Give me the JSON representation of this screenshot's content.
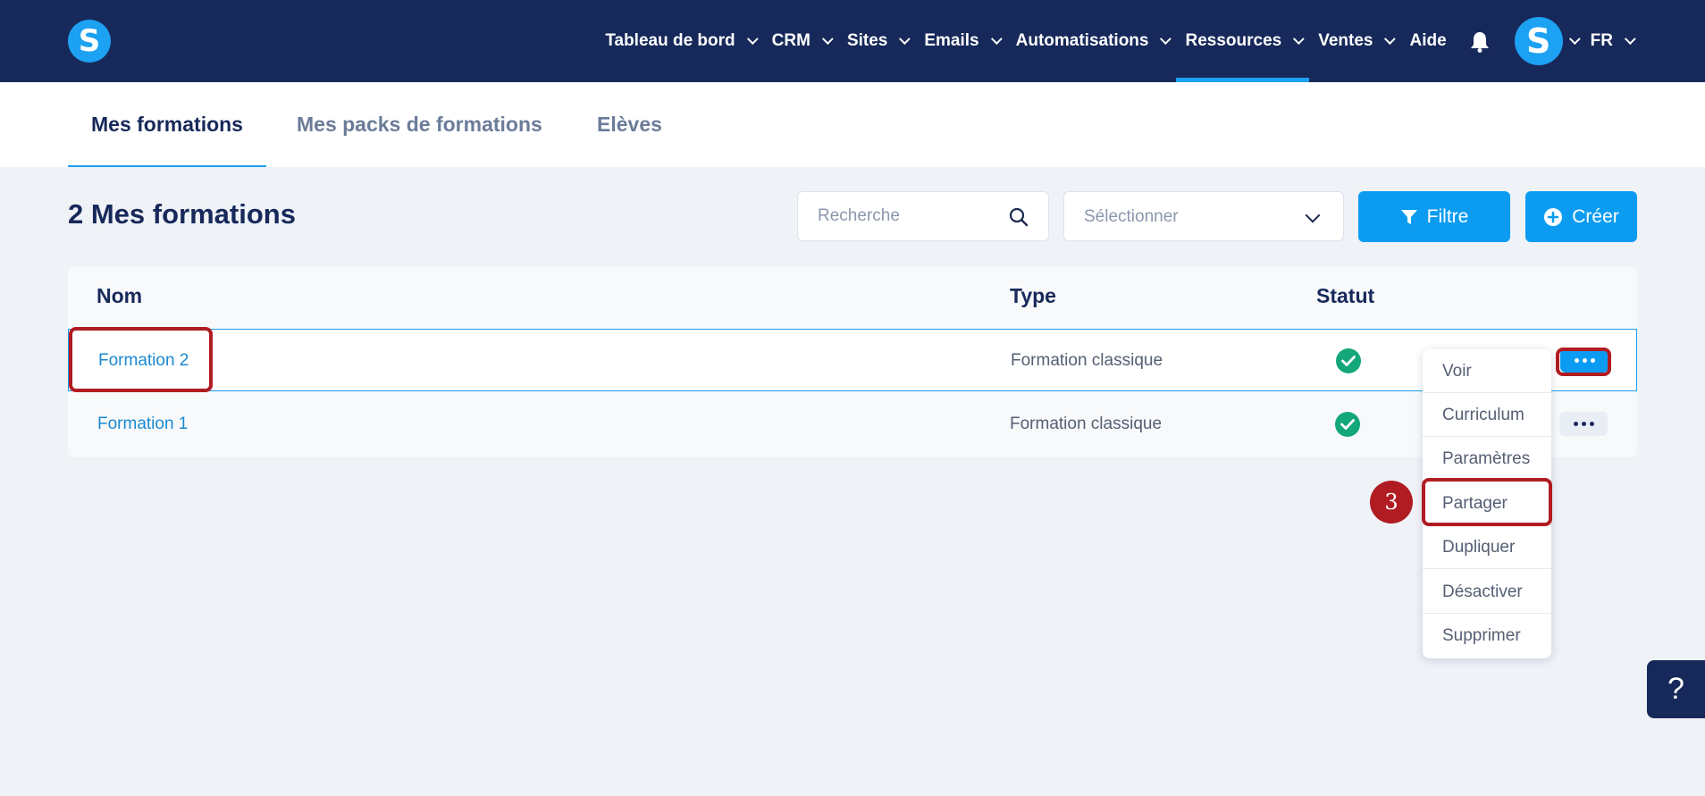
{
  "nav": {
    "items": [
      {
        "label": "Tableau de bord",
        "dropdown": true
      },
      {
        "label": "CRM",
        "dropdown": true
      },
      {
        "label": "Sites",
        "dropdown": true
      },
      {
        "label": "Emails",
        "dropdown": true
      },
      {
        "label": "Automatisations",
        "dropdown": true
      },
      {
        "label": "Ressources",
        "dropdown": true,
        "active": true
      },
      {
        "label": "Ventes",
        "dropdown": true
      },
      {
        "label": "Aide",
        "dropdown": false
      }
    ],
    "logo_letter": "S",
    "avatar_letter": "S",
    "language": "FR"
  },
  "tabs": [
    {
      "label": "Mes formations",
      "active": true
    },
    {
      "label": "Mes packs de formations",
      "active": false
    },
    {
      "label": "Elèves",
      "active": false
    }
  ],
  "toolbar": {
    "title": "2 Mes formations",
    "search_placeholder": "Recherche",
    "select_placeholder": "Sélectionner",
    "filter_label": "Filtre",
    "create_label": "Créer"
  },
  "table": {
    "headers": {
      "name": "Nom",
      "type": "Type",
      "status": "Statut"
    },
    "rows": [
      {
        "name": "Formation 2",
        "type": "Formation classique",
        "status": "active"
      },
      {
        "name": "Formation 1",
        "type": "Formation classique",
        "status": "active"
      }
    ]
  },
  "menu": {
    "items": [
      "Voir",
      "Curriculum",
      "Paramètres",
      "Partager",
      "Dupliquer",
      "Désactiver",
      "Supprimer"
    ]
  },
  "annotation": {
    "step": "3"
  },
  "help": {
    "label": "?"
  },
  "colors": {
    "navbar": "#17295a",
    "accent": "#1da1f2",
    "button": "#0b9cf2",
    "success": "#14a77a",
    "highlight": "#b01c22"
  }
}
